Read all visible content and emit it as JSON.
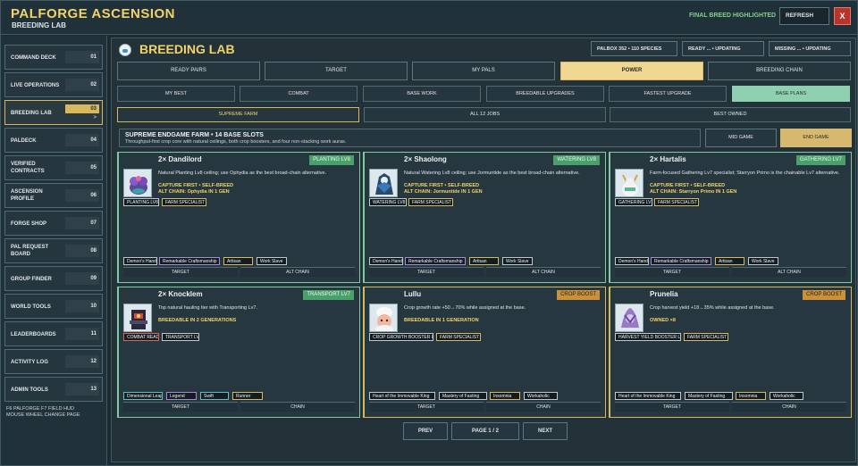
{
  "header": {
    "title": "PALFORGE ASCENSION",
    "subtitle": "BREEDING LAB",
    "final_breed": "FINAL BREED HIGHLIGHTED",
    "refresh_label": "REFRESH",
    "close_label": "X"
  },
  "sidebar": {
    "items": [
      {
        "label": "COMMAND DECK",
        "num": "01"
      },
      {
        "label": "LIVE OPERATIONS",
        "num": "02"
      },
      {
        "label": "BREEDING LAB",
        "num": "03"
      },
      {
        "label": "PALDECK",
        "num": "04"
      },
      {
        "label": "VERIFIED CONTRACTS",
        "num": "05"
      },
      {
        "label": "ASCENSION PROFILE",
        "num": "06"
      },
      {
        "label": "FORGE SHOP",
        "num": "07"
      },
      {
        "label": "PAL REQUEST BOARD",
        "num": "08"
      },
      {
        "label": "GROUP FINDER",
        "num": "09"
      },
      {
        "label": "WORLD TOOLS",
        "num": "10"
      },
      {
        "label": "LEADERBOARDS",
        "num": "11"
      },
      {
        "label": "ACTIVITY LOG",
        "num": "12"
      },
      {
        "label": "ADMIN TOOLS",
        "num": "13"
      }
    ],
    "active_chevron": ">",
    "hint_1": "F6 PALFORGE   F7 FIELD HUD",
    "hint_2": "MOUSE WHEEL  CHANGE PAGE"
  },
  "lab": {
    "title": "BREEDING LAB",
    "stats": [
      "PALBOX 352 • 110 SPECIES",
      "READY ... • UPDATING",
      "MISSING ... • UPDATING"
    ]
  },
  "tabs": [
    "READY PAIRS",
    "TARGET",
    "MY PALS",
    "POWER",
    "BREEDING CHAIN"
  ],
  "subtabs": [
    "MY BEST",
    "COMBAT",
    "BASE WORK",
    "BREEDABLE UPGRADES",
    "FASTEST UPGRADE",
    "BASE PLANS"
  ],
  "plans": [
    "SUPREME FARM",
    "ALL 12 JOBS",
    "BEST OWNED"
  ],
  "farm": {
    "title": "SUPREME ENDGAME FARM • 14 BASE SLOTS",
    "desc": "Throughput-first crop core with natural ceilings, both crop boosters, and four non-stacking work auras."
  },
  "game_modes": [
    "MID GAME",
    "END GAME"
  ],
  "cards": [
    {
      "name": "2×  Dandilord",
      "tag": "PLANTING LV8",
      "desc": "Natural Planting Lv8 ceiling; use Ophydia as the best broad-chain alternative.",
      "hl1": "CAPTURE FIRST • SELF-BREED",
      "hl2": "ALT CHAIN: Ophydia IN 1 GEN",
      "chips": [
        "PLANTING LV8",
        "FARM SPECIALIST"
      ],
      "passives": [
        "Demon's Hand",
        "Remarkable Craftsmanship",
        "Artisan",
        "Work Slave"
      ],
      "actions": [
        "TARGET",
        "ALT CHAIN"
      ]
    },
    {
      "name": "2×  Shaolong",
      "tag": "WATERING LV8",
      "desc": "Natural Watering Lv8 ceiling; use Jormuntide as the best broad-chain alternative.",
      "hl1": "CAPTURE FIRST • SELF-BREED",
      "hl2": "ALT CHAIN: Jormuntide IN 1 GEN",
      "chips": [
        "WATERING LV8",
        "FARM SPECIALIST"
      ],
      "passives": [
        "Demon's Hand",
        "Remarkable Craftsmanship",
        "Artisan",
        "Work Slave"
      ],
      "actions": [
        "TARGET",
        "ALT CHAIN"
      ]
    },
    {
      "name": "2×  Hartalis",
      "tag": "GATHERING LV7",
      "desc": "Farm-focused Gathering Lv7 specialist; Starryon Primo is the chainable Lv7 alternative.",
      "hl1": "CAPTURE FIRST • SELF-BREED",
      "hl2": "ALT CHAIN: Starryon Primo IN 1 GEN",
      "chips": [
        "GATHERING LV7",
        "FARM SPECIALIST"
      ],
      "passives": [
        "Demon's Hand",
        "Remarkable Craftsmanship",
        "Artisan",
        "Work Slave"
      ],
      "actions": [
        "TARGET",
        "ALT CHAIN"
      ]
    },
    {
      "name": "2×  Knocklem",
      "tag": "TRANSPORT LV7",
      "desc": "Top natural hauling tier with Transporting Lv7.",
      "hl1": "BREEDABLE IN 2 GENERATIONS",
      "hl2": "",
      "chips": [
        "COMBAT READY",
        "TRANSPORT LV7"
      ],
      "passives": [
        "Dimensional Leap",
        "Legend",
        "Swift",
        "Runner"
      ],
      "actions": [
        "TARGET",
        "CHAIN"
      ]
    },
    {
      "name": "Lullu",
      "tag": "CROP BOOST",
      "desc": "Crop growth rate +50→70% while assigned at the base.",
      "hl1": "BREEDABLE IN 1 GENERATION",
      "hl2": "",
      "chips": [
        "CROP GROWTH BOOSTER LV3",
        "FARM SPECIALIST"
      ],
      "passives": [
        "Heart of the Immovable King",
        "Mastery of Fasting",
        "Insomnia",
        "Workaholic"
      ],
      "actions": [
        "TARGET",
        "CHAIN"
      ]
    },
    {
      "name": "Prunelia",
      "tag": "CROP BOOST",
      "desc": "Crop harvest yield +18→35% while assigned at the base.",
      "hl1": "OWNED ×8",
      "hl2": "",
      "chips": [
        "HARVEST YIELD BOOSTER LV3",
        "FARM SPECIALIST"
      ],
      "passives": [
        "Heart of the Immovable King",
        "Mastery of Fasting",
        "Insomnia",
        "Workaholic"
      ],
      "actions": [
        "TARGET",
        "CHAIN"
      ]
    }
  ],
  "pager": {
    "prev": "PREV",
    "page": "PAGE  1 / 2",
    "next": "NEXT"
  },
  "colors": {
    "accent": "#f0d36b",
    "green": "#7fcaa0",
    "gold": "#d7b85c",
    "close": "#b8352b"
  }
}
